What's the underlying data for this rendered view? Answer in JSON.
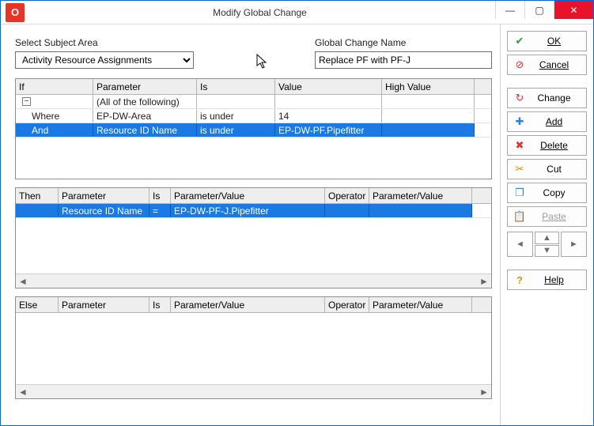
{
  "window": {
    "title": "Modify Global Change"
  },
  "labels": {
    "subject_area": "Select Subject Area",
    "change_name": "Global Change Name"
  },
  "fields": {
    "subject_area": "Activity Resource Assignments",
    "change_name": "Replace PF with PF-J"
  },
  "if_grid": {
    "headers": {
      "c1": "If",
      "c2": "Parameter",
      "c3": "Is",
      "c4": "Value",
      "c5": "High Value"
    },
    "rows": [
      {
        "c1": "",
        "c2": "(All of the following)",
        "c3": "",
        "c4": "",
        "c5": "",
        "toggle": true
      },
      {
        "c1": "Where",
        "c2": "EP-DW-Area",
        "c3": "is under",
        "c4": "14",
        "c5": ""
      },
      {
        "c1": "And",
        "c2": "Resource ID Name",
        "c3": "is under",
        "c4": "EP-DW-PF.Pipefitter",
        "c5": "",
        "selected": true
      }
    ]
  },
  "then_grid": {
    "headers": {
      "c1": "Then",
      "c2": "Parameter",
      "c3": "Is",
      "c4": "Parameter/Value",
      "c5": "Operator",
      "c6": "Parameter/Value"
    },
    "rows": [
      {
        "c1": "",
        "c2": "Resource ID Name",
        "c3": "=",
        "c4": "EP-DW-PF-J.Pipefitter",
        "c5": "",
        "c6": "",
        "selected": true
      }
    ]
  },
  "else_grid": {
    "headers": {
      "c1": "Else",
      "c2": "Parameter",
      "c3": "Is",
      "c4": "Parameter/Value",
      "c5": "Operator",
      "c6": "Parameter/Value"
    },
    "rows": []
  },
  "sidebar": {
    "ok": "OK",
    "cancel": "Cancel",
    "change": "Change",
    "add": "Add",
    "delete": "Delete",
    "cut": "Cut",
    "copy": "Copy",
    "paste": "Paste",
    "help": "Help"
  },
  "icons": {
    "ok": "✔",
    "cancel": "⊘",
    "change": "↻",
    "add": "✚",
    "delete": "✖",
    "cut": "✂",
    "copy": "❐",
    "paste": "📋",
    "help": "?"
  }
}
